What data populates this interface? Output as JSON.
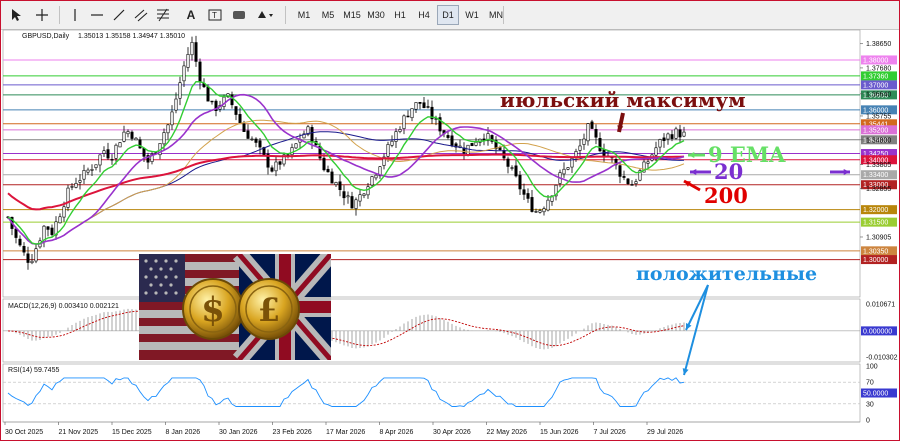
{
  "toolbar": {
    "timeframes": [
      "M1",
      "M5",
      "M15",
      "M30",
      "H1",
      "H4",
      "D1",
      "W1",
      "MN"
    ],
    "active_timeframe": "D1"
  },
  "header": {
    "symbol": "GBPUSD,Daily",
    "ohlc": "1.35013 1.35158 1.34947 1.35010"
  },
  "indicators": {
    "macd_label": "MACD(12,26,9) 0.003410 0.002121",
    "rsi_label": "RSI(14) 59.7455"
  },
  "annotations": {
    "july_max": "июльский максимум",
    "ema9": "9 EMA",
    "ma20": "20",
    "ma200": "200",
    "positive": "положительные"
  },
  "colors": {
    "ema9": "#32cd32",
    "ma20": "#9932cc",
    "ma200": "#dc143c",
    "ma_tan": "#d2a24c",
    "ma_navy": "#1a1a8c",
    "candle": "#000000",
    "rsi": "#1e90ff",
    "macd_signal": "#c00000",
    "annotation_dark": "#7b0f0f",
    "annotation_purple": "#7b2fd0",
    "annotation_red": "#e00000",
    "annotation_green": "#66e066",
    "annotation_blue": "#1e8fe0"
  },
  "chart_data": {
    "type": "candlestick",
    "symbol": "GBPUSD",
    "timeframe": "Daily",
    "ylim": [
      1.285,
      1.392
    ],
    "price_ticks": [
      "1.38650",
      "1.37680",
      "1.36640",
      "1.35755",
      "1.34800",
      "1.33805",
      "1.32855",
      "1.30905"
    ],
    "levels": [
      {
        "value": 1.38,
        "label": "1.38000",
        "color": "#ee82ee"
      },
      {
        "value": 1.3736,
        "label": "1.37360",
        "color": "#32cd32"
      },
      {
        "value": 1.37,
        "label": "1.37000",
        "color": "#6a5acd"
      },
      {
        "value": 1.366,
        "label": "1.36600",
        "color": "#2e8b57"
      },
      {
        "value": 1.36,
        "label": "1.36000",
        "color": "#4682b4"
      },
      {
        "value": 1.35441,
        "label": "1.35441",
        "color": "#d2691e"
      },
      {
        "value": 1.352,
        "label": "1.35200",
        "color": "#da70d6"
      },
      {
        "value": 1.348,
        "label": "1.34800",
        "color": "#808080"
      },
      {
        "value": 1.3425,
        "label": "1.34250",
        "color": "#9932cc"
      },
      {
        "value": 1.34,
        "label": "1.34000",
        "color": "#dc143c"
      },
      {
        "value": 1.334,
        "label": "1.33400",
        "color": "#a9a9a9"
      },
      {
        "value": 1.33,
        "label": "1.33000",
        "color": "#b22222"
      },
      {
        "value": 1.32,
        "label": "1.32000",
        "color": "#b8860b"
      },
      {
        "value": 1.315,
        "label": "1.31500",
        "color": "#9acd32"
      },
      {
        "value": 1.3035,
        "label": "1.30350",
        "color": "#cd853f"
      },
      {
        "value": 1.3,
        "label": "1.30000",
        "color": "#b22222"
      }
    ],
    "date_labels": [
      "30 Oct 2025",
      "21 Nov 2025",
      "15 Dec 2025",
      "8 Jan 2026",
      "30 Jan 2026",
      "23 Feb 2026",
      "17 Mar 2026",
      "8 Apr 2026",
      "30 Apr 2026",
      "22 May 2026",
      "15 Jun 2026",
      "7 Jul 2026",
      "29 Jul 2026"
    ],
    "close_path": [
      1.317,
      1.309,
      1.303,
      1.299,
      1.306,
      1.314,
      1.311,
      1.318,
      1.326,
      1.331,
      1.333,
      1.336,
      1.339,
      1.344,
      1.341,
      1.347,
      1.352,
      1.35,
      1.344,
      1.339,
      1.343,
      1.35,
      1.355,
      1.366,
      1.378,
      1.387,
      1.374,
      1.366,
      1.36,
      1.363,
      1.365,
      1.359,
      1.352,
      1.349,
      1.345,
      1.34,
      1.336,
      1.339,
      1.341,
      1.345,
      1.35,
      1.352,
      1.344,
      1.337,
      1.333,
      1.329,
      1.325,
      1.322,
      1.326,
      1.331,
      1.335,
      1.341,
      1.346,
      1.352,
      1.357,
      1.361,
      1.363,
      1.36,
      1.356,
      1.352,
      1.349,
      1.346,
      1.344,
      1.346,
      1.349,
      1.35,
      1.346,
      1.342,
      1.338,
      1.333,
      1.327,
      1.322,
      1.319,
      1.322,
      1.327,
      1.333,
      1.337,
      1.341,
      1.346,
      1.353,
      1.348,
      1.343,
      1.341,
      1.336,
      1.332,
      1.33,
      1.335,
      1.339,
      1.344,
      1.348,
      1.35,
      1.351,
      1.35
    ],
    "macd": {
      "label": "MACD(12,26,9)",
      "main": 0.00341,
      "signal": 0.002121,
      "ticks": [
        "0.010671",
        "0.000000",
        "-0.010302"
      ],
      "ylim": [
        -0.0115,
        0.0118
      ]
    },
    "rsi": {
      "label": "RSI(14)",
      "value": 59.7455,
      "ticks": [
        "100",
        "70",
        "50",
        "30",
        "0"
      ],
      "ylim": [
        0,
        100
      ]
    }
  }
}
